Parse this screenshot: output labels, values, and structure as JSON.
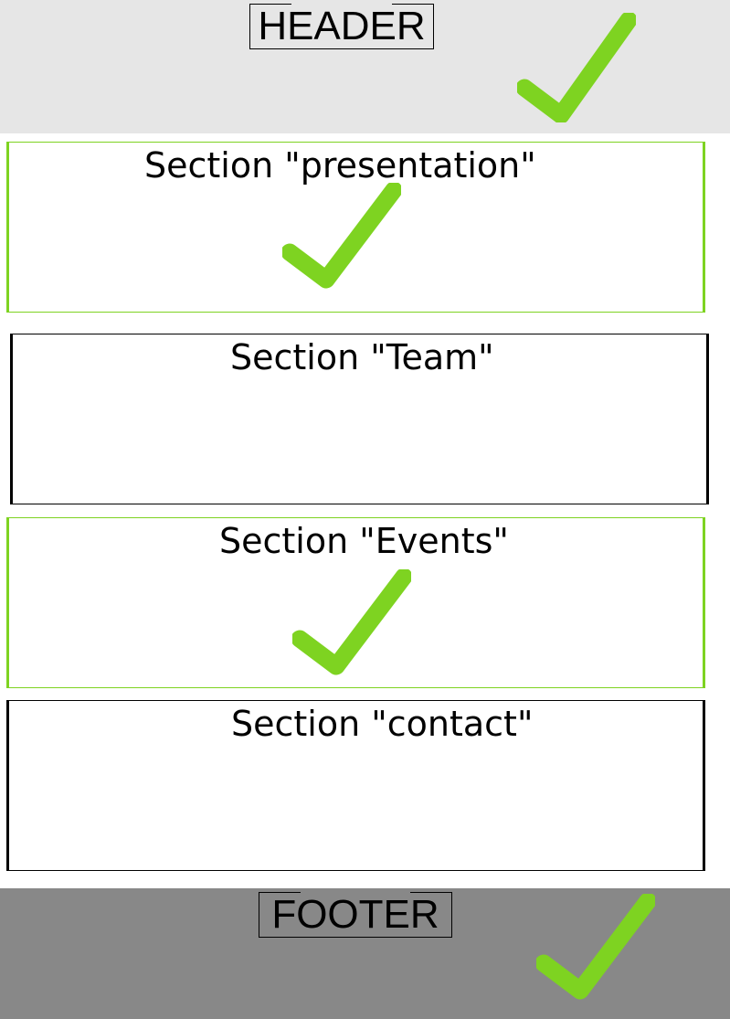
{
  "colors": {
    "header_background": "#e6e6e6",
    "footer_background": "#888888",
    "check_green": "#7ed321",
    "done_border": "#7ed321",
    "pending_border": "#000000"
  },
  "header": {
    "label": "HEADER",
    "done": true
  },
  "footer": {
    "label": "FOOTER",
    "done": true
  },
  "sections": [
    {
      "title": "Section \"presentation\"",
      "done": true
    },
    {
      "title": "Section \"Team\"",
      "done": false
    },
    {
      "title": "Section \"Events\"",
      "done": true
    },
    {
      "title": "Section \"contact\"",
      "done": false
    }
  ],
  "icons": {
    "done_marker": "checkmark-icon"
  }
}
